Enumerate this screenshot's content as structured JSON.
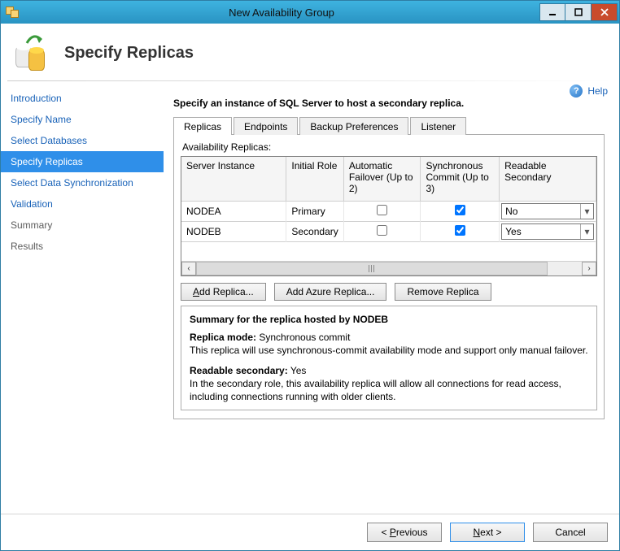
{
  "window": {
    "title": "New Availability Group"
  },
  "header": {
    "title": "Specify Replicas"
  },
  "help": {
    "label": "Help"
  },
  "sidebar": {
    "items": [
      {
        "label": "Introduction",
        "state": "link"
      },
      {
        "label": "Specify Name",
        "state": "link"
      },
      {
        "label": "Select Databases",
        "state": "link"
      },
      {
        "label": "Specify Replicas",
        "state": "active"
      },
      {
        "label": "Select Data Synchronization",
        "state": "link"
      },
      {
        "label": "Validation",
        "state": "link"
      },
      {
        "label": "Summary",
        "state": "done"
      },
      {
        "label": "Results",
        "state": "done"
      }
    ]
  },
  "main": {
    "instruction": "Specify an instance of SQL Server to host a secondary replica.",
    "tabs": [
      "Replicas",
      "Endpoints",
      "Backup Preferences",
      "Listener"
    ],
    "active_tab_index": 0,
    "availability_label": "Availability Replicas:",
    "columns": [
      "Server Instance",
      "Initial Role",
      "Automatic Failover (Up to 2)",
      "Synchronous Commit (Up to 3)",
      "Readable Secondary"
    ],
    "rows": [
      {
        "server": "NODEA",
        "role": "Primary",
        "auto_failover": false,
        "sync_commit": true,
        "readable": "No"
      },
      {
        "server": "NODEB",
        "role": "Secondary",
        "auto_failover": false,
        "sync_commit": true,
        "readable": "Yes"
      }
    ],
    "buttons": {
      "add": "Add Replica...",
      "azure": "Add Azure Replica...",
      "remove": "Remove Replica"
    },
    "summary": {
      "title": "Summary for the replica hosted by NODEB",
      "mode_label": "Replica mode:",
      "mode_value": " Synchronous commit",
      "mode_desc": "This replica will use synchronous-commit availability mode and support only manual failover.",
      "readable_label": "Readable secondary:",
      "readable_value": " Yes",
      "readable_desc": "In the secondary role, this availability replica will allow all connections for read access, including connections running with older clients."
    }
  },
  "footer": {
    "previous": "Previous",
    "next": "Next >",
    "cancel": "Cancel",
    "lt": "< ",
    "nlabel": "N",
    "nrest": "ext >"
  }
}
